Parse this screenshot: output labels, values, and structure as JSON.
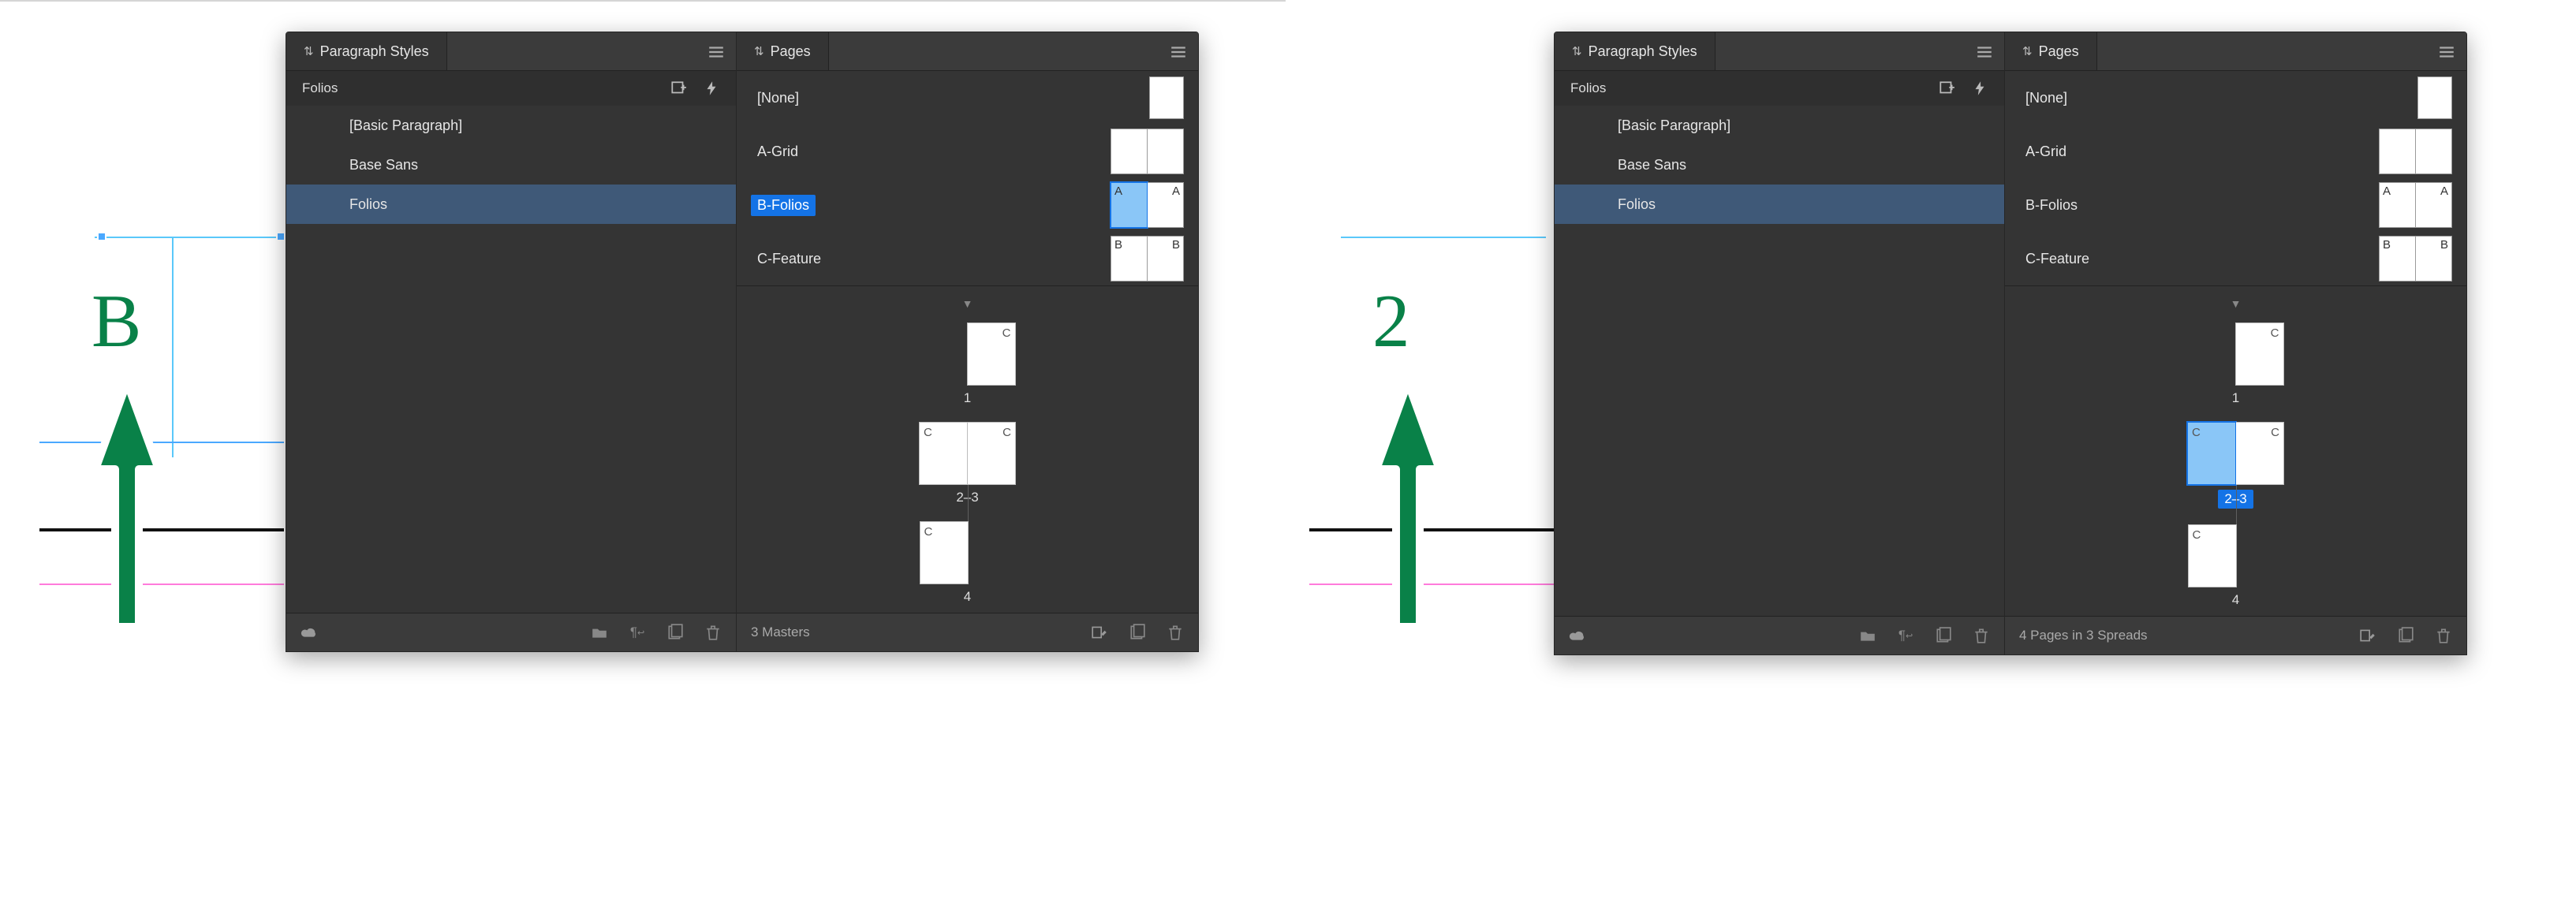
{
  "left": {
    "marker_text": "B",
    "paragraph_panel": {
      "title": "Paragraph Styles",
      "current_style": "Folios",
      "styles": [
        {
          "name": "[Basic Paragraph]",
          "indent": true,
          "selected": false
        },
        {
          "name": "Base Sans",
          "indent": true,
          "selected": false
        },
        {
          "name": "Folios",
          "indent": true,
          "selected": true
        }
      ]
    },
    "pages_panel": {
      "title": "Pages",
      "masters": [
        {
          "name": "[None]",
          "selected": false,
          "letters": [
            null
          ],
          "single": true
        },
        {
          "name": "A-Grid",
          "selected": false,
          "letters": [
            null,
            null
          ]
        },
        {
          "name": "B-Folios",
          "selected": true,
          "letters": [
            "A",
            "A"
          ],
          "thumb_selected": true
        },
        {
          "name": "C-Feature",
          "selected": false,
          "letters": [
            "B",
            "B"
          ]
        }
      ],
      "spreads": [
        {
          "label": "1",
          "pages": [
            {
              "lt": null,
              "rt": "C"
            }
          ],
          "selected": false,
          "offset": "recto"
        },
        {
          "label": "2–3",
          "pages": [
            {
              "lt": "C",
              "rt": null
            },
            {
              "lt": null,
              "rt": "C"
            }
          ],
          "selected": false
        },
        {
          "label": "4",
          "pages": [
            {
              "lt": "C",
              "rt": null
            }
          ],
          "selected": false,
          "offset": "verso"
        }
      ],
      "footer_text": "3 Masters"
    }
  },
  "right": {
    "marker_text": "2",
    "paragraph_panel": {
      "title": "Paragraph Styles",
      "current_style": "Folios",
      "styles": [
        {
          "name": "[Basic Paragraph]",
          "indent": true,
          "selected": false
        },
        {
          "name": "Base Sans",
          "indent": true,
          "selected": false
        },
        {
          "name": "Folios",
          "indent": true,
          "selected": true
        }
      ]
    },
    "pages_panel": {
      "title": "Pages",
      "masters": [
        {
          "name": "[None]",
          "selected": false,
          "letters": [
            null
          ],
          "single": true
        },
        {
          "name": "A-Grid",
          "selected": false,
          "letters": [
            null,
            null
          ]
        },
        {
          "name": "B-Folios",
          "selected": false,
          "letters": [
            "A",
            "A"
          ]
        },
        {
          "name": "C-Feature",
          "selected": false,
          "letters": [
            "B",
            "B"
          ]
        }
      ],
      "spreads": [
        {
          "label": "1",
          "pages": [
            {
              "lt": null,
              "rt": "C"
            }
          ],
          "selected": false,
          "offset": "recto"
        },
        {
          "label": "2–3",
          "pages": [
            {
              "lt": "C",
              "rt": null,
              "sel": true
            },
            {
              "lt": null,
              "rt": "C"
            }
          ],
          "selected": true
        },
        {
          "label": "4",
          "pages": [
            {
              "lt": "C",
              "rt": null
            }
          ],
          "selected": false,
          "offset": "verso"
        }
      ],
      "footer_text": "4 Pages in 3 Spreads"
    }
  }
}
